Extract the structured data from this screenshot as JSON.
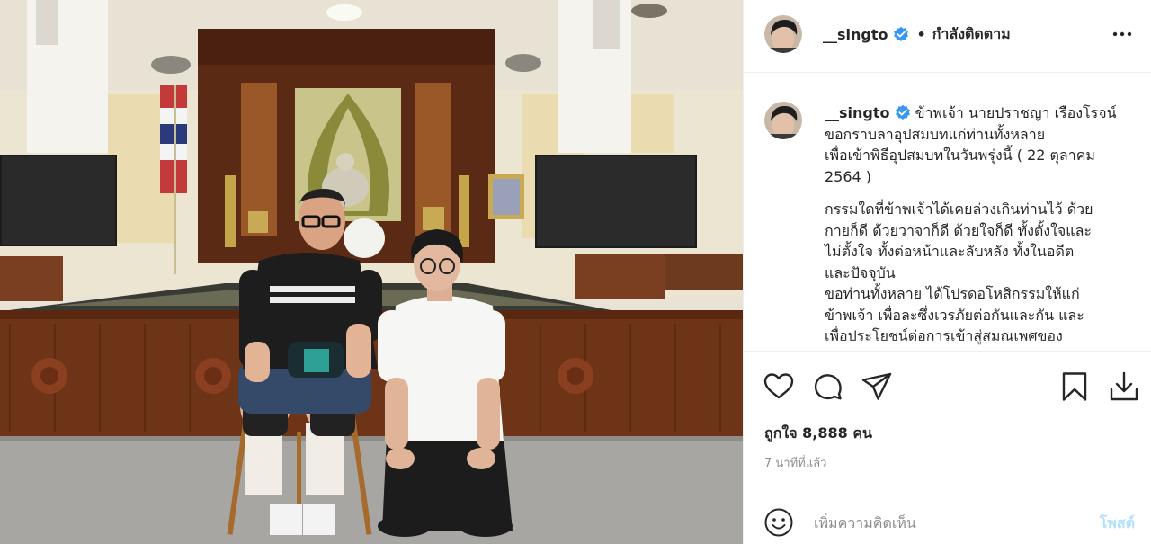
{
  "photo": {
    "alt_icon": "photo-post"
  },
  "header": {
    "username": "__singto",
    "verified_icon": "verified-badge-icon",
    "separator": "•",
    "follow_status": "กำลังติดตาม",
    "more_icon": "more-options-icon"
  },
  "caption": {
    "username": "__singto",
    "line1": " ข้าพเจ้า นายปราชญา เรืองโรจน์\nขอกราบลาอุปสมบทแก่ท่านทั้งหลาย\nเพื่อเข้าพิธีอุปสมบทในวันพรุ่งนี้ ( 22 ตุลาคม\n2564 )",
    "para2": "กรรมใดที่ข้าพเจ้าได้เคยล่วงเกินท่านไว้ ด้วย\nกายก็ดี ด้วยวาจาก็ดี ด้วยใจก็ดี ทั้งตั้งใจและ\nไม่ตั้งใจ ทั้งต่อหน้าและลับหลัง ทั้งในอดีต\nและปัจจุบัน\nขอท่านทั้งหลาย ได้โปรดอโหสิกรรมให้แก่\nข้าพเจ้า เพื่อละซึ่งเวรภัยต่อกันและกัน และ\nเพื่อประโยชน์ต่อการเข้าสู่สมณเพศของ"
  },
  "actions": {
    "like_icon": "heart-icon",
    "comment_icon": "comment-icon",
    "share_icon": "share-icon",
    "save_icon": "bookmark-icon",
    "download_icon": "download-icon",
    "likes_text": "ถูกใจ 8,888 คน",
    "time_ago": "7 นาทีที่แล้ว"
  },
  "comment": {
    "emoji_icon": "emoji-icon",
    "placeholder": "เพิ่มความคิดเห็น",
    "post_label": "โพสต์"
  },
  "colors": {
    "verified_blue": "#3897f0",
    "muted_text": "#8e8e8e",
    "post_disabled": "#b2dffc",
    "divider": "#efefef"
  }
}
